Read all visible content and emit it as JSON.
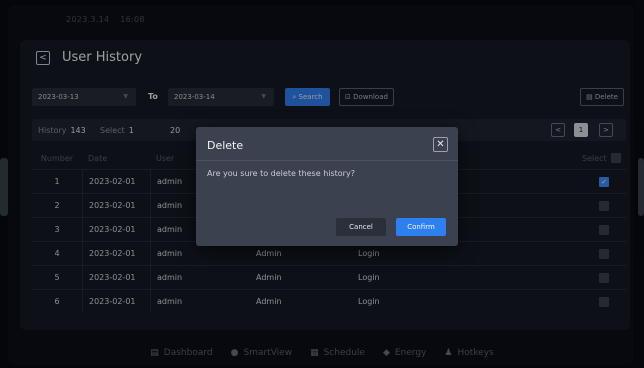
{
  "status": {
    "date": "2023.3.14",
    "time": "16:08"
  },
  "header": {
    "back_icon": "chevron-left-icon",
    "title": "User History"
  },
  "filters": {
    "start_date": "2023-03-13",
    "to_label": "To",
    "end_date": "2023-03-14",
    "search_label": "Search",
    "download_label": "Download",
    "delete_label": "Delete"
  },
  "info": {
    "history_label": "History",
    "history_count": "143",
    "select_label": "Select",
    "select_count": "1",
    "partial": "20"
  },
  "pager": {
    "prev": "<",
    "current": "1",
    "next": ">"
  },
  "table": {
    "columns": [
      "Number",
      "Date",
      "User",
      "Select"
    ],
    "rows": [
      {
        "num": "1",
        "date": "2023-02-01",
        "user": "admin",
        "role": "",
        "action": "",
        "checked": true
      },
      {
        "num": "2",
        "date": "2023-02-01",
        "user": "admin",
        "role": "",
        "action": "",
        "checked": false
      },
      {
        "num": "3",
        "date": "2023-02-01",
        "user": "admin",
        "role": "",
        "action": "",
        "checked": false
      },
      {
        "num": "4",
        "date": "2023-02-01",
        "user": "admin",
        "role": "Admin",
        "action": "Login",
        "checked": false
      },
      {
        "num": "5",
        "date": "2023-02-01",
        "user": "admin",
        "role": "Admin",
        "action": "Login",
        "checked": false
      },
      {
        "num": "6",
        "date": "2023-02-01",
        "user": "admin",
        "role": "Admin",
        "action": "Login",
        "checked": false
      }
    ]
  },
  "dialog": {
    "title": "Delete",
    "message": "Are you sure to delete these history?",
    "cancel": "Cancel",
    "confirm": "Confirm"
  },
  "nav": [
    {
      "label": "Dashboard",
      "icon": "dashboard-icon"
    },
    {
      "label": "SmartView",
      "icon": "smartview-icon"
    },
    {
      "label": "Schedule",
      "icon": "schedule-icon"
    },
    {
      "label": "Energy",
      "icon": "energy-icon"
    },
    {
      "label": "Hotkeys",
      "icon": "hotkeys-icon"
    }
  ],
  "colors": {
    "accent": "#2e7ff0",
    "dialog_bg": "#3c4150",
    "panel_bg": "#141924"
  }
}
